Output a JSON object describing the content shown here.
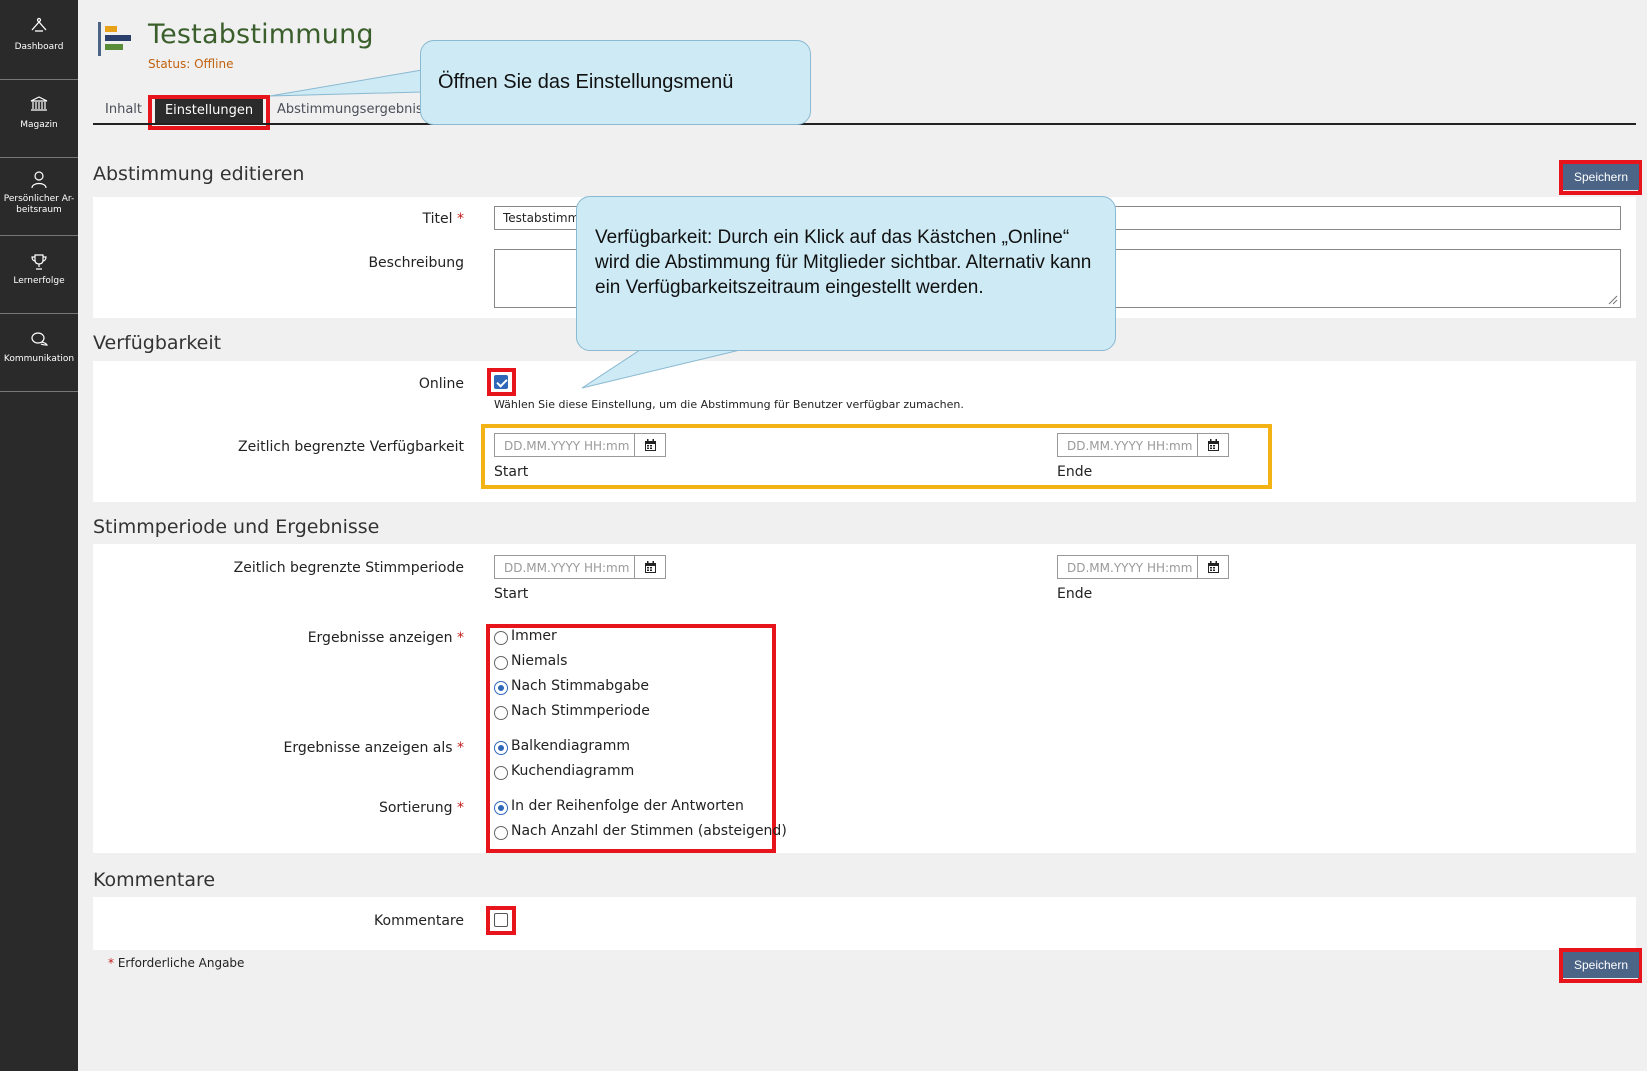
{
  "sidebar": {
    "items": [
      {
        "label": "Dashboard",
        "icon": "dashboard-icon"
      },
      {
        "label": "Magazin",
        "icon": "bank-icon"
      },
      {
        "label": "Persönlicher Ar-beitsraum",
        "icon": "user-icon"
      },
      {
        "label": "Lernerfolge",
        "icon": "trophy-icon"
      },
      {
        "label": "Kommunikation",
        "icon": "chat-icon"
      }
    ]
  },
  "header": {
    "title": "Testabstimmung",
    "status": "Status: Offline"
  },
  "tabs": [
    {
      "label": "Inhalt",
      "active": false
    },
    {
      "label": "Einstellungen",
      "active": true
    },
    {
      "label": "Abstimmungsergebnisse",
      "active": false
    }
  ],
  "callouts": {
    "settings_menu": "Öffnen Sie das Einstellungsmenü",
    "availability": "Verfügbarkeit: Durch ein Klick auf das Kästchen „Online“ wird die Abstimmung für Mitglieder sichtbar. Alternativ kann ein Verfügbarkeitszeitraum eingestellt werden."
  },
  "edit_section": {
    "title": "Abstimmung editieren",
    "save_label": "Speichern",
    "title_label": "Titel",
    "title_value": "Testabstimmung",
    "description_label": "Beschreibung",
    "description_value": ""
  },
  "availability": {
    "title": "Verfügbarkeit",
    "online_label": "Online",
    "online_checked": true,
    "online_help": "Wählen Sie diese Einstellung, um die Abstimmung für Benutzer verfügbar zumachen.",
    "limited_label": "Zeitlich begrenzte Verfügbarkeit",
    "start_placeholder": "DD.MM.YYYY HH:mm",
    "end_placeholder": "DD.MM.YYYY HH:mm",
    "start_label": "Start",
    "end_label": "Ende"
  },
  "voting": {
    "title": "Stimmperiode und Ergebnisse",
    "period_label": "Zeitlich begrenzte Stimmperiode",
    "start_placeholder": "DD.MM.YYYY HH:mm",
    "end_placeholder": "DD.MM.YYYY HH:mm",
    "start_label": "Start",
    "end_label": "Ende",
    "show_results_label": "Ergebnisse anzeigen",
    "show_results_options": [
      "Immer",
      "Niemals",
      "Nach Stimmabgabe",
      "Nach Stimmperiode"
    ],
    "show_results_selected": "Nach Stimmabgabe",
    "show_as_label": "Ergebnisse anzeigen als",
    "show_as_options": [
      "Balkendiagramm",
      "Kuchendiagramm"
    ],
    "show_as_selected": "Balkendiagramm",
    "sort_label": "Sortierung",
    "sort_options": [
      "In der Reihenfolge der Antworten",
      "Nach Anzahl der Stimmen (absteigend)"
    ],
    "sort_selected": "In der Reihenfolge der Antworten"
  },
  "comments": {
    "title": "Kommentare",
    "label": "Kommentare",
    "checked": false
  },
  "footer": {
    "required_note": "Erforderliche Angabe",
    "asterisk": "*",
    "save_label": "Speichern"
  },
  "colors": {
    "sidebar": "#2a2a2a",
    "title_green": "#3b5f2c",
    "status_orange": "#c2610e",
    "button": "#4c6586",
    "highlight_red": "#e8141c",
    "highlight_orange": "#f4b314",
    "callout_fill": "#cdeaf5",
    "checkbox_blue": "#2f68b8"
  }
}
